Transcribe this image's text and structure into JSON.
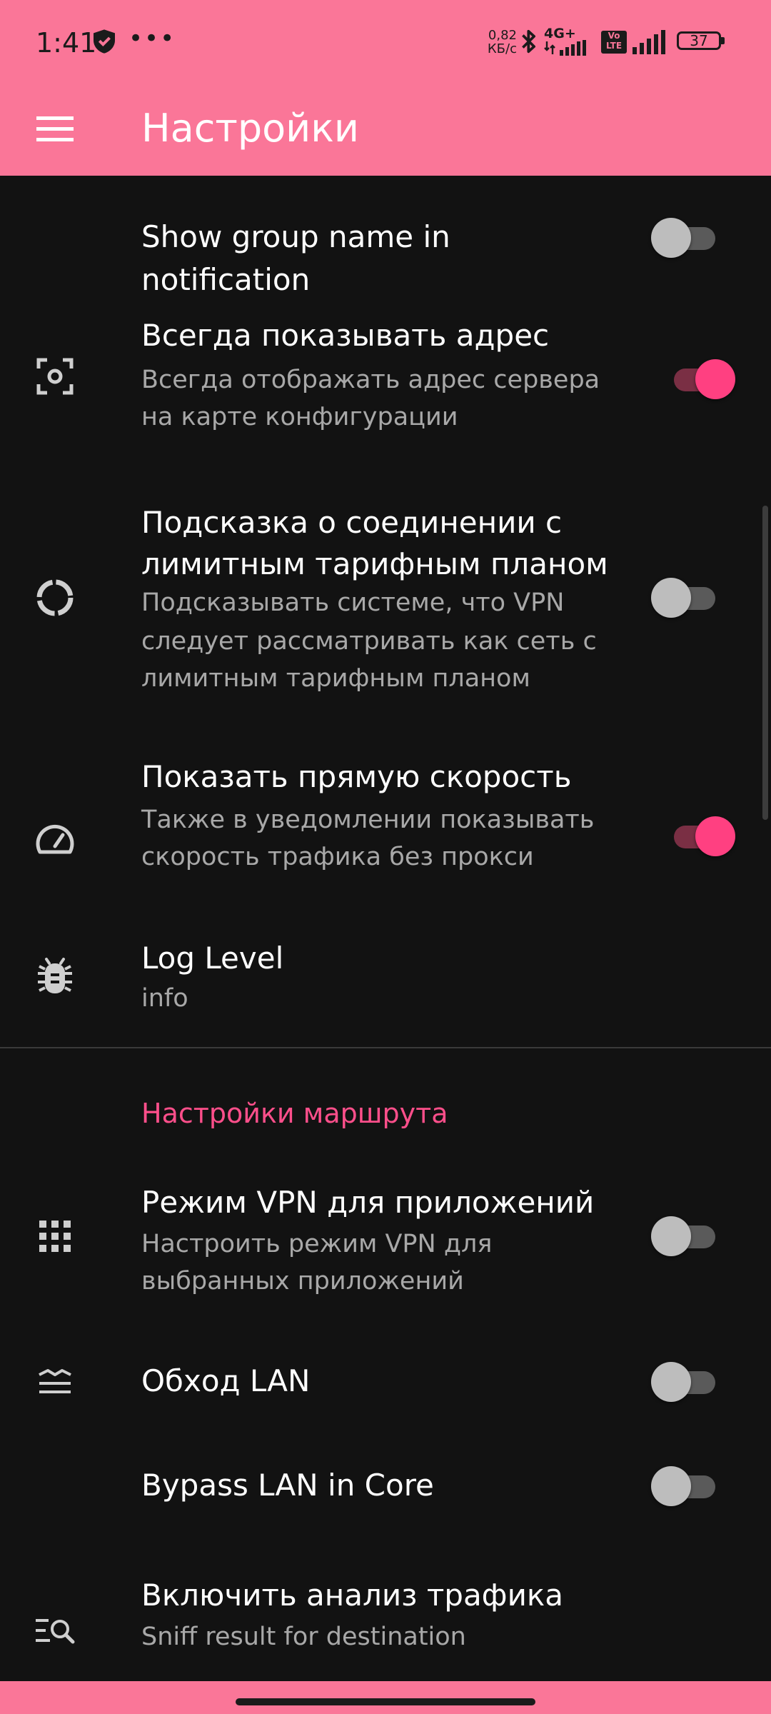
{
  "status_bar": {
    "time": "1:41",
    "dots": "•••",
    "speed_value": "0,82",
    "speed_unit": "КБ/с",
    "network": "4G+",
    "volte_top": "Vo",
    "volte_bottom": "LTE",
    "battery": "37"
  },
  "toolbar": {
    "title": "Настройки",
    "menu_icon": "hamburger-menu-icon"
  },
  "colors": {
    "accent": "#FA7698",
    "switch_on": "#FF4081",
    "section_header": "#FF4F8B",
    "background": "#121212"
  },
  "settings": {
    "group_name": {
      "title": "Show group name in notification",
      "enabled": false
    },
    "always_show_address": {
      "title": "Всегда показывать адрес",
      "summary_line1": "Всегда отображать адрес сервера",
      "summary_line2": "на карте конфигурации",
      "enabled": true,
      "icon": "scan-frame-icon"
    },
    "metered_hint": {
      "title_line1": "Подсказка о соединении с",
      "title_line2": "лимитным тарифным планом",
      "summary_line1": "Подсказывать системе, что VPN",
      "summary_line2": "следует рассматривать как сеть с",
      "summary_line3": "лимитным тарифным планом",
      "enabled": false,
      "icon": "circle-progress-icon"
    },
    "direct_speed": {
      "title": "Показать прямую скорость",
      "summary_line1": "Также в уведомлении показывать",
      "summary_line2": "скорость трафика без прокси",
      "enabled": true,
      "icon": "speedometer-icon"
    },
    "log_level": {
      "title": "Log Level",
      "value": "info",
      "icon": "bug-icon"
    }
  },
  "route_section": {
    "header": "Настройки маршрута",
    "app_vpn": {
      "title": "Режим VPN для приложений",
      "summary_line1": "Настроить режим VPN для",
      "summary_line2": "выбранных приложений",
      "enabled": false,
      "icon": "apps-grid-icon"
    },
    "bypass_lan": {
      "title": "Обход LAN",
      "enabled": false,
      "icon": "lan-layers-icon"
    },
    "bypass_lan_core": {
      "title": "Bypass LAN in Core",
      "enabled": false
    },
    "traffic_sniffing": {
      "title": "Включить анализ трафика",
      "summary": "Sniff result for destination",
      "icon": "list-search-icon"
    }
  }
}
